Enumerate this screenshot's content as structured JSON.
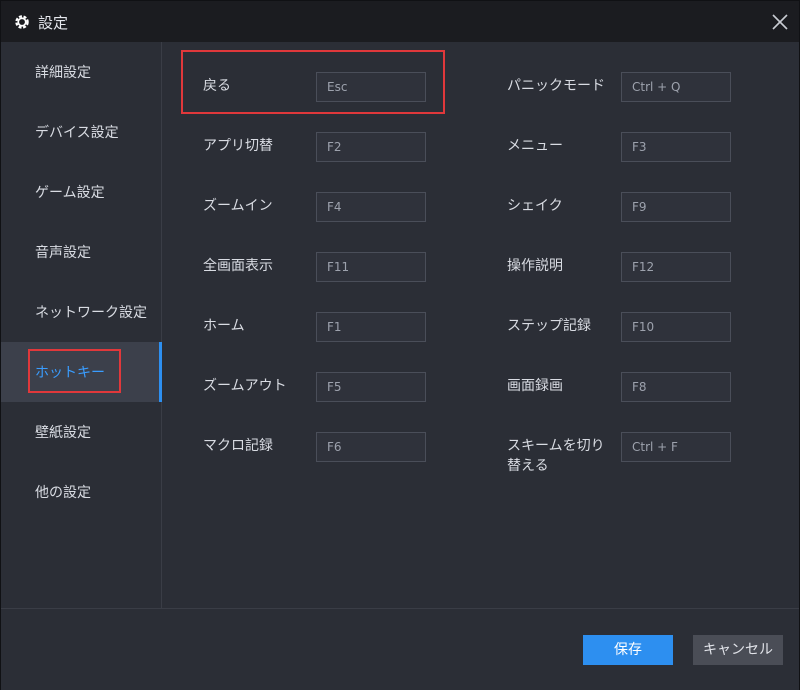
{
  "window": {
    "title": "設定"
  },
  "sidebar": {
    "active_index": 5,
    "items": [
      {
        "label": "詳細設定"
      },
      {
        "label": "デバイス設定"
      },
      {
        "label": "ゲーム設定"
      },
      {
        "label": "音声設定"
      },
      {
        "label": "ネットワーク設定"
      },
      {
        "label": "ホットキー"
      },
      {
        "label": "壁紙設定"
      },
      {
        "label": "他の設定"
      }
    ]
  },
  "hotkeys": {
    "left": [
      {
        "label": "戻る",
        "key": "Esc"
      },
      {
        "label": "アプリ切替",
        "key": "F2"
      },
      {
        "label": "ズームイン",
        "key": "F4"
      },
      {
        "label": "全画面表示",
        "key": "F11"
      },
      {
        "label": "ホーム",
        "key": "F1"
      },
      {
        "label": "ズームアウト",
        "key": "F5"
      },
      {
        "label": "マクロ記録",
        "key": "F6"
      }
    ],
    "right": [
      {
        "label": "パニックモード",
        "key": "Ctrl + Q"
      },
      {
        "label": "メニュー",
        "key": "F3"
      },
      {
        "label": "シェイク",
        "key": "F9"
      },
      {
        "label": "操作説明",
        "key": "F12"
      },
      {
        "label": "ステップ記録",
        "key": "F10"
      },
      {
        "label": "画面録画",
        "key": "F8"
      },
      {
        "label": "スキームを切り替える",
        "label_line1": "スキームを切り",
        "label_line2": "替える",
        "key": "Ctrl + F"
      }
    ]
  },
  "footer": {
    "save_label": "保存",
    "cancel_label": "キャンセル"
  },
  "colors": {
    "accent": "#2d8ff0",
    "highlight": "#e0383b",
    "background": "#2b2e36",
    "titlebar": "#1b1c20"
  },
  "icons": {
    "title": "gear-icon",
    "close": "close-icon"
  }
}
